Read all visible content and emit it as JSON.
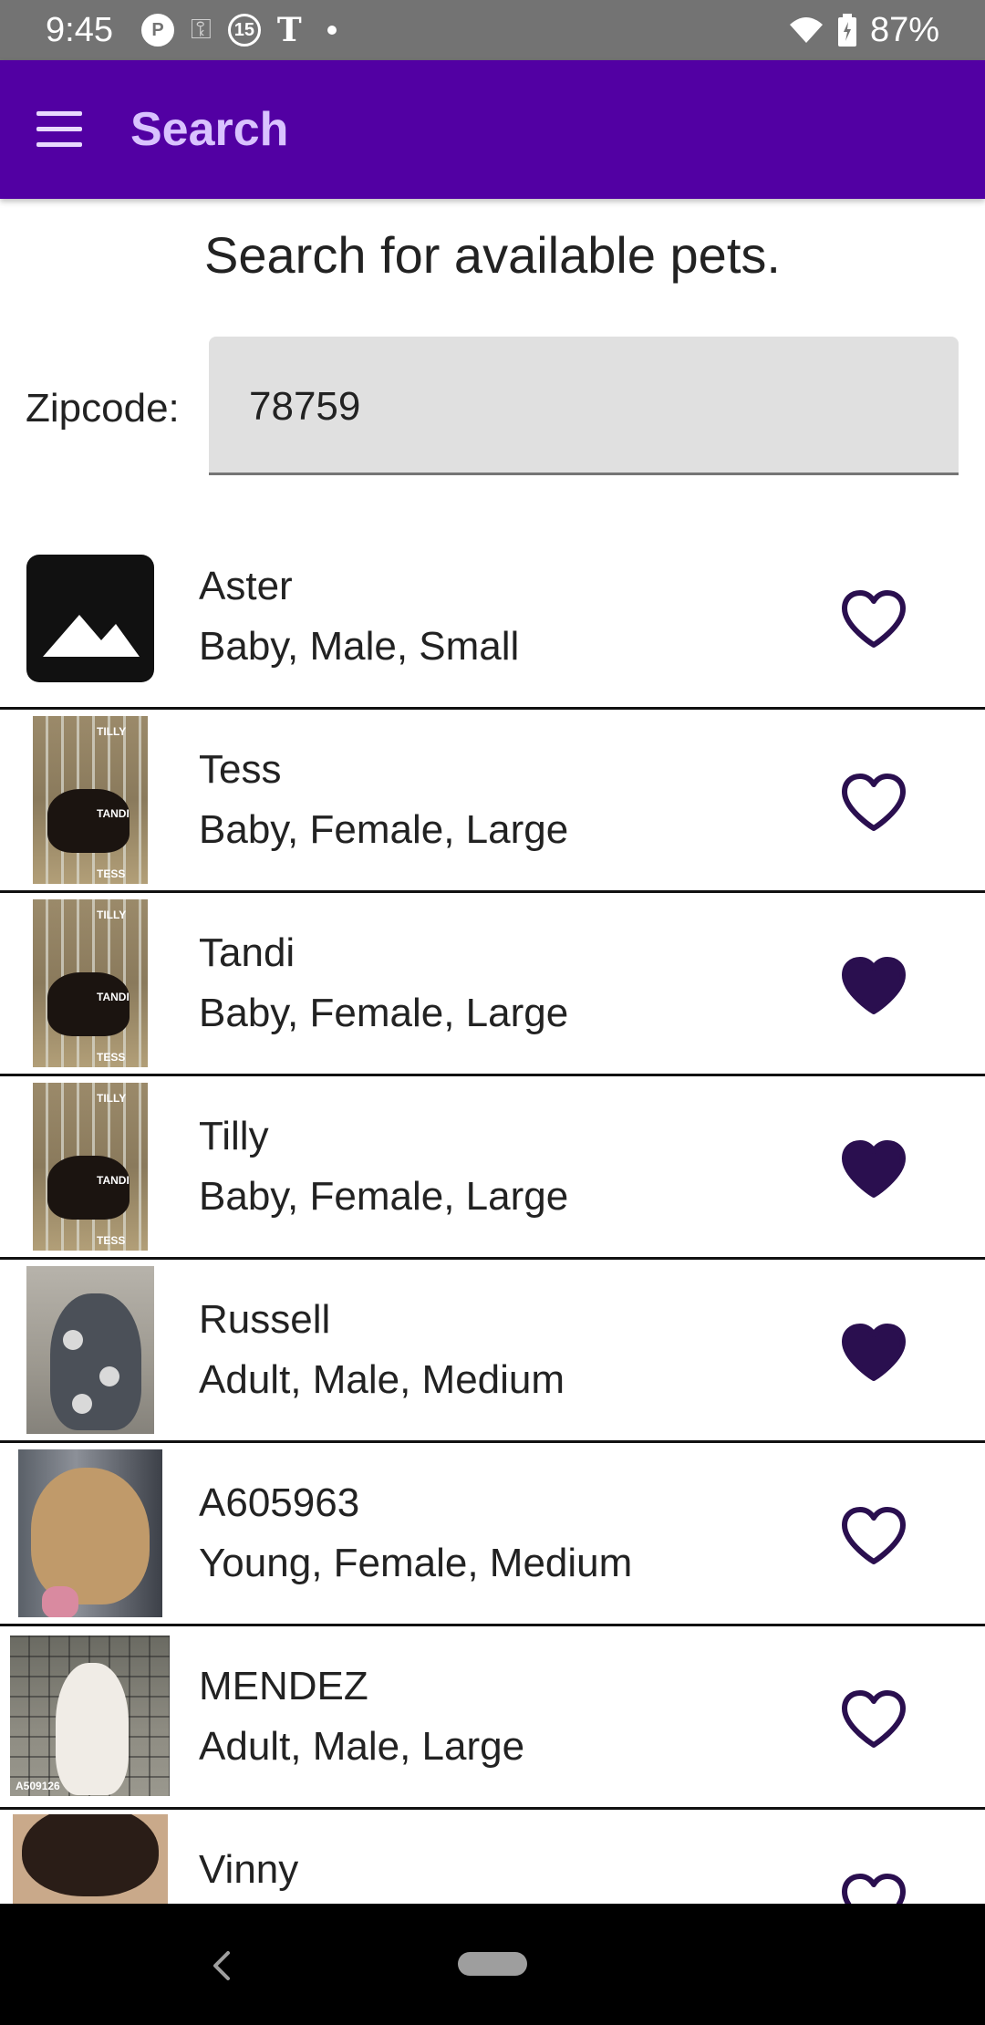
{
  "status_bar": {
    "time": "9:45",
    "battery": "87%",
    "icons": [
      "pandora-icon",
      "key-icon",
      "circle-15-icon",
      "nyt-icon",
      "dot-icon",
      "wifi-icon",
      "battery-icon"
    ]
  },
  "app_bar": {
    "title": "Search",
    "menu_icon": "menu-icon",
    "background": "#5200a3"
  },
  "page": {
    "heading": "Search for available pets."
  },
  "zipcode": {
    "label": "Zipcode:",
    "value": "78759"
  },
  "pets": [
    {
      "name": "Aster",
      "details": "Baby, Male, Small",
      "favorited": false
    },
    {
      "name": "Tess",
      "details": "Baby, Female, Large",
      "favorited": false
    },
    {
      "name": "Tandi",
      "details": "Baby, Female, Large",
      "favorited": true
    },
    {
      "name": "Tilly",
      "details": "Baby, Female, Large",
      "favorited": true
    },
    {
      "name": "Russell",
      "details": "Adult, Male, Medium",
      "favorited": true
    },
    {
      "name": "A605963",
      "details": "Young, Female, Medium",
      "favorited": false
    },
    {
      "name": "MENDEZ",
      "details": "Adult, Male, Large",
      "favorited": false
    },
    {
      "name": "Vinny",
      "details": "",
      "favorited": false
    }
  ],
  "photo_text": {
    "tilly_tag": "TILLY",
    "tandi_tag": "TANDI",
    "tess_tag": "TESS",
    "mendez_code": "A509126"
  },
  "colors": {
    "heart": "#2a0f4f",
    "accent": "#5200a3"
  }
}
